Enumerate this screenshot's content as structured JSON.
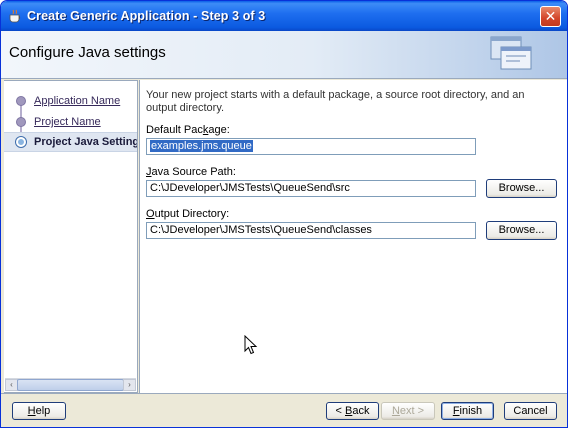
{
  "window": {
    "title": "Create Generic Application - Step 3 of 3",
    "close_glyph": "✕"
  },
  "header": {
    "title": "Configure Java settings"
  },
  "nav": {
    "items": [
      {
        "label": "Application Name",
        "state": "done"
      },
      {
        "label": "Project Name",
        "state": "done"
      },
      {
        "label": "Project Java Settings",
        "state": "current"
      }
    ],
    "scroll_left": "‹",
    "scroll_right": "›"
  },
  "content": {
    "intro": "Your new project starts with a default package, a source root directory, and an output directory.",
    "default_package": {
      "label_pre": "Default Pac",
      "label_mnemonic": "k",
      "label_post": "age:",
      "value": "examples.jms.queue"
    },
    "java_source_path": {
      "label_pre": "",
      "label_mnemonic": "J",
      "label_post": "ava Source Path:",
      "value": "C:\\JDeveloper\\JMSTests\\QueueSend\\src",
      "browse_label": "Browse..."
    },
    "output_directory": {
      "label_pre": "",
      "label_mnemonic": "O",
      "label_post": "utput Directory:",
      "value": "C:\\JDeveloper\\JMSTests\\QueueSend\\classes",
      "browse_label": "Browse..."
    }
  },
  "footer": {
    "help": {
      "mnemonic": "H",
      "rest": "elp"
    },
    "back": {
      "pre": "< ",
      "mnemonic": "B",
      "rest": "ack"
    },
    "next": {
      "mnemonic": "N",
      "rest": "ext >"
    },
    "finish": {
      "mnemonic": "F",
      "rest": "inish"
    },
    "cancel": "Cancel"
  },
  "colors": {
    "title_bar": "#0a5fe8",
    "selection": "#316ac5",
    "link": "#36295a"
  }
}
